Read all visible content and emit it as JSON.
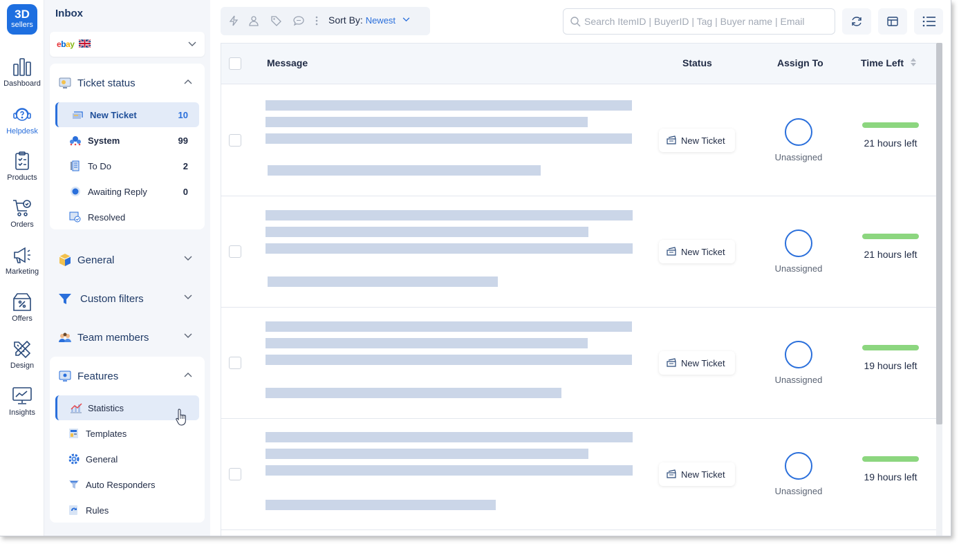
{
  "app": {
    "logo_line1": "3D",
    "logo_line2": "sellers"
  },
  "rail": [
    {
      "label": "Dashboard",
      "icon": "bar-chart-icon"
    },
    {
      "label": "Helpdesk",
      "icon": "helpdesk-icon",
      "active": true
    },
    {
      "label": "Products",
      "icon": "clipboard-icon"
    },
    {
      "label": "Orders",
      "icon": "cart-icon"
    },
    {
      "label": "Marketing",
      "icon": "megaphone-icon"
    },
    {
      "label": "Offers",
      "icon": "offer-box-icon"
    },
    {
      "label": "Design",
      "icon": "design-tools-icon"
    },
    {
      "label": "Insights",
      "icon": "monitor-chart-icon"
    }
  ],
  "sidebar": {
    "title": "Inbox",
    "marketplace": "ebay",
    "ticket_status": {
      "title": "Ticket status",
      "items": [
        {
          "label": "New Ticket",
          "count": "10",
          "active": true
        },
        {
          "label": "System",
          "count": "99"
        },
        {
          "label": "To Do",
          "count": "2"
        },
        {
          "label": "Awaiting Reply",
          "count": "0"
        },
        {
          "label": "Resolved",
          "count": ""
        }
      ]
    },
    "general": "General",
    "custom_filters": "Custom filters",
    "team_members": "Team members",
    "features": {
      "title": "Features",
      "items": [
        {
          "label": "Statistics",
          "active": true
        },
        {
          "label": "Templates"
        },
        {
          "label": "General"
        },
        {
          "label": "Auto Responders"
        },
        {
          "label": "Rules"
        }
      ]
    }
  },
  "toolbar": {
    "sort_label": "Sort By:",
    "sort_value": "Newest",
    "search_placeholder": "Search ItemID | BuyerID | Tag | Buyer name | Email"
  },
  "table": {
    "headers": {
      "message": "Message",
      "status": "Status",
      "assign": "Assign To",
      "time": "Time Left"
    },
    "rows": [
      {
        "status": "New Ticket",
        "assign": "Unassigned",
        "time_left": "21 hours left"
      },
      {
        "status": "New Ticket",
        "assign": "Unassigned",
        "time_left": "21 hours left"
      },
      {
        "status": "New Ticket",
        "assign": "Unassigned",
        "time_left": "19 hours left"
      },
      {
        "status": "New Ticket",
        "assign": "Unassigned",
        "time_left": "19 hours left"
      }
    ]
  },
  "colors": {
    "accent": "#2a6fdb",
    "time_bar": "#8cd67f",
    "skeleton": "#cbd6e8"
  }
}
